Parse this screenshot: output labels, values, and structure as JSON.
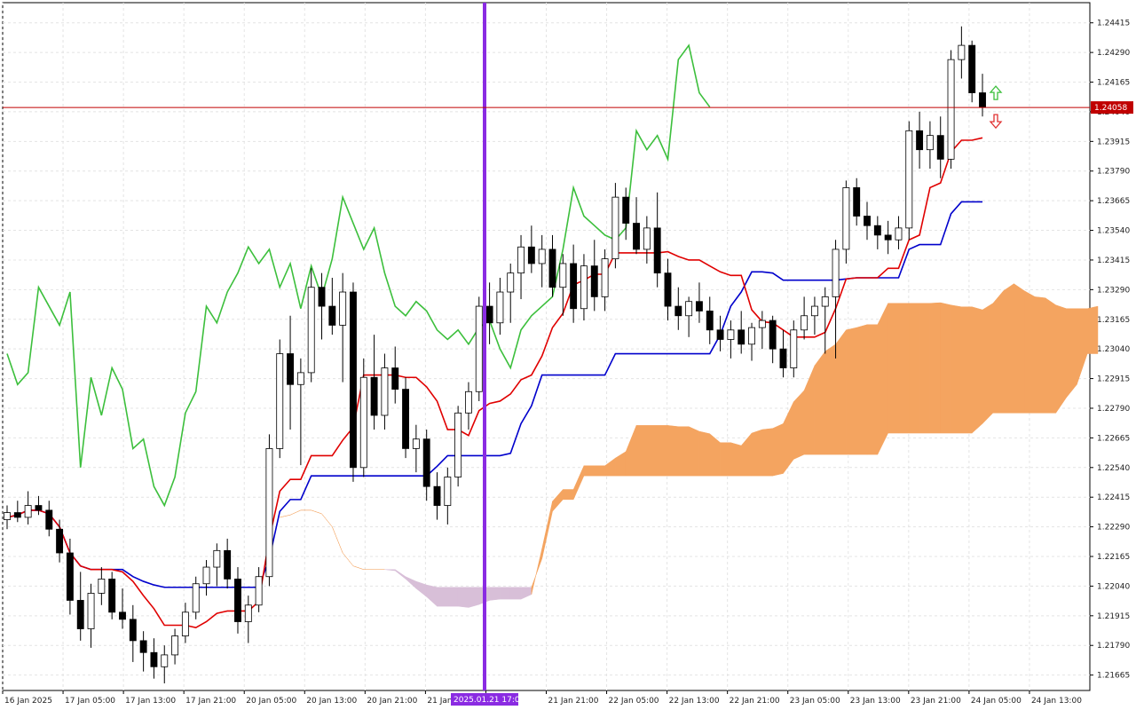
{
  "chart_data": {
    "type": "candlestick",
    "indicator": "Ichimoku Kinko Hyo",
    "price_axis": {
      "ticks": [
        "1.24415",
        "1.24290",
        "1.24165",
        "1.24040",
        "1.23915",
        "1.23790",
        "1.23665",
        "1.23540",
        "1.23415",
        "1.23290",
        "1.23165",
        "1.23040",
        "1.22915",
        "1.22790",
        "1.22665",
        "1.22540",
        "1.22415",
        "1.22290",
        "1.22165",
        "1.22040",
        "1.21915",
        "1.21790",
        "1.21665"
      ],
      "range": [
        1.216,
        1.245
      ]
    },
    "time_axis": {
      "ticks": [
        "16 Jan 2025",
        "17 Jan 05:00",
        "17 Jan 13:00",
        "17 Jan 21:00",
        "20 Jan 05:00",
        "20 Jan 13:00",
        "20 Jan 21:00",
        "21 Jan 05:00",
        "2025.01.21 17:00",
        "21 Jan 21:00",
        "22 Jan 05:00",
        "22 Jan 13:00",
        "22 Jan 21:00",
        "23 Jan 05:00",
        "23 Jan 13:00",
        "23 Jan 21:00",
        "24 Jan 05:00",
        "24 Jan 13:00"
      ]
    },
    "current_price": "1.24058",
    "crosshair_label": "2025.01.21 17:00",
    "colors": {
      "bull_body": "#ffffff",
      "bear_body": "#000000",
      "wick": "#000000",
      "tenkan": "#e00000",
      "kijun": "#0000cc",
      "chikou": "#3cbf3c",
      "bull_cloud": "#f4a460",
      "bear_cloud": "#d8bfd8",
      "crosshair": "#8a2be2",
      "price_line": "#c00000",
      "arrow_up": "#3cbf3c",
      "arrow_down": "#e03030"
    },
    "candles": [
      {
        "o": 1.2232,
        "h": 1.2238,
        "l": 1.2228,
        "c": 1.2235
      },
      {
        "o": 1.2235,
        "h": 1.224,
        "l": 1.2231,
        "c": 1.2233
      },
      {
        "o": 1.2233,
        "h": 1.2244,
        "l": 1.223,
        "c": 1.2238
      },
      {
        "o": 1.2238,
        "h": 1.2242,
        "l": 1.2234,
        "c": 1.2236
      },
      {
        "o": 1.2236,
        "h": 1.224,
        "l": 1.2225,
        "c": 1.2228
      },
      {
        "o": 1.2228,
        "h": 1.2232,
        "l": 1.2214,
        "c": 1.2218
      },
      {
        "o": 1.2218,
        "h": 1.2224,
        "l": 1.2192,
        "c": 1.2198
      },
      {
        "o": 1.2198,
        "h": 1.221,
        "l": 1.2181,
        "c": 1.2186
      },
      {
        "o": 1.2186,
        "h": 1.2205,
        "l": 1.2178,
        "c": 1.2201
      },
      {
        "o": 1.2201,
        "h": 1.2212,
        "l": 1.2196,
        "c": 1.2207
      },
      {
        "o": 1.2207,
        "h": 1.221,
        "l": 1.219,
        "c": 1.2193
      },
      {
        "o": 1.2193,
        "h": 1.2203,
        "l": 1.2186,
        "c": 1.219
      },
      {
        "o": 1.219,
        "h": 1.2196,
        "l": 1.2172,
        "c": 1.2181
      },
      {
        "o": 1.2181,
        "h": 1.2185,
        "l": 1.2168,
        "c": 1.2176
      },
      {
        "o": 1.2176,
        "h": 1.2182,
        "l": 1.2165,
        "c": 1.217
      },
      {
        "o": 1.217,
        "h": 1.2179,
        "l": 1.2163,
        "c": 1.2175
      },
      {
        "o": 1.2175,
        "h": 1.2186,
        "l": 1.2171,
        "c": 1.2183
      },
      {
        "o": 1.2183,
        "h": 1.2197,
        "l": 1.218,
        "c": 1.2193
      },
      {
        "o": 1.2193,
        "h": 1.2208,
        "l": 1.219,
        "c": 1.2205
      },
      {
        "o": 1.2205,
        "h": 1.2215,
        "l": 1.22,
        "c": 1.2212
      },
      {
        "o": 1.2212,
        "h": 1.2222,
        "l": 1.2204,
        "c": 1.2219
      },
      {
        "o": 1.2219,
        "h": 1.2224,
        "l": 1.2203,
        "c": 1.2207
      },
      {
        "o": 1.2207,
        "h": 1.2212,
        "l": 1.2184,
        "c": 1.2189
      },
      {
        "o": 1.2189,
        "h": 1.22,
        "l": 1.218,
        "c": 1.2196
      },
      {
        "o": 1.2196,
        "h": 1.2212,
        "l": 1.2193,
        "c": 1.2208
      },
      {
        "o": 1.2208,
        "h": 1.2268,
        "l": 1.2204,
        "c": 1.2262
      },
      {
        "o": 1.2262,
        "h": 1.2308,
        "l": 1.2258,
        "c": 1.2302
      },
      {
        "o": 1.2302,
        "h": 1.2318,
        "l": 1.227,
        "c": 1.2289
      },
      {
        "o": 1.2289,
        "h": 1.23,
        "l": 1.2255,
        "c": 1.2294
      },
      {
        "o": 1.2294,
        "h": 1.2338,
        "l": 1.229,
        "c": 1.233
      },
      {
        "o": 1.233,
        "h": 1.2336,
        "l": 1.2308,
        "c": 1.2322
      },
      {
        "o": 1.2322,
        "h": 1.2334,
        "l": 1.231,
        "c": 1.2314
      },
      {
        "o": 1.2314,
        "h": 1.2336,
        "l": 1.229,
        "c": 1.2328
      },
      {
        "o": 1.2328,
        "h": 1.2332,
        "l": 1.2248,
        "c": 1.2254
      },
      {
        "o": 1.2254,
        "h": 1.23,
        "l": 1.225,
        "c": 1.2292
      },
      {
        "o": 1.2292,
        "h": 1.231,
        "l": 1.227,
        "c": 1.2276
      },
      {
        "o": 1.2276,
        "h": 1.2302,
        "l": 1.227,
        "c": 1.2296
      },
      {
        "o": 1.2296,
        "h": 1.2305,
        "l": 1.2281,
        "c": 1.2287
      },
      {
        "o": 1.2287,
        "h": 1.2292,
        "l": 1.2258,
        "c": 1.2262
      },
      {
        "o": 1.2262,
        "h": 1.2272,
        "l": 1.2252,
        "c": 1.2266
      },
      {
        "o": 1.2266,
        "h": 1.227,
        "l": 1.224,
        "c": 1.2246
      },
      {
        "o": 1.2246,
        "h": 1.2252,
        "l": 1.2232,
        "c": 1.2238
      },
      {
        "o": 1.2238,
        "h": 1.2254,
        "l": 1.223,
        "c": 1.225
      },
      {
        "o": 1.225,
        "h": 1.228,
        "l": 1.2246,
        "c": 1.2277
      },
      {
        "o": 1.2277,
        "h": 1.229,
        "l": 1.227,
        "c": 1.2286
      },
      {
        "o": 1.2286,
        "h": 1.2326,
        "l": 1.2282,
        "c": 1.2322
      },
      {
        "o": 1.2322,
        "h": 1.2332,
        "l": 1.2306,
        "c": 1.2315
      },
      {
        "o": 1.2315,
        "h": 1.2334,
        "l": 1.231,
        "c": 1.2328
      },
      {
        "o": 1.2328,
        "h": 1.234,
        "l": 1.2315,
        "c": 1.2336
      },
      {
        "o": 1.2336,
        "h": 1.2352,
        "l": 1.2325,
        "c": 1.2347
      },
      {
        "o": 1.2347,
        "h": 1.2356,
        "l": 1.2336,
        "c": 1.234
      },
      {
        "o": 1.234,
        "h": 1.2352,
        "l": 1.233,
        "c": 1.2346
      },
      {
        "o": 1.2346,
        "h": 1.2352,
        "l": 1.2326,
        "c": 1.233
      },
      {
        "o": 1.233,
        "h": 1.2344,
        "l": 1.2318,
        "c": 1.234
      },
      {
        "o": 1.234,
        "h": 1.2348,
        "l": 1.2315,
        "c": 1.2321
      },
      {
        "o": 1.2321,
        "h": 1.2344,
        "l": 1.2316,
        "c": 1.2339
      },
      {
        "o": 1.2339,
        "h": 1.235,
        "l": 1.232,
        "c": 1.2326
      },
      {
        "o": 1.2326,
        "h": 1.2346,
        "l": 1.232,
        "c": 1.2342
      },
      {
        "o": 1.2342,
        "h": 1.2374,
        "l": 1.2338,
        "c": 1.2368
      },
      {
        "o": 1.2368,
        "h": 1.2372,
        "l": 1.235,
        "c": 1.2357
      },
      {
        "o": 1.2357,
        "h": 1.2368,
        "l": 1.2344,
        "c": 1.2346
      },
      {
        "o": 1.2346,
        "h": 1.236,
        "l": 1.234,
        "c": 1.2355
      },
      {
        "o": 1.2355,
        "h": 1.237,
        "l": 1.233,
        "c": 1.2336
      },
      {
        "o": 1.2336,
        "h": 1.2342,
        "l": 1.2316,
        "c": 1.2322
      },
      {
        "o": 1.2322,
        "h": 1.233,
        "l": 1.2312,
        "c": 1.2318
      },
      {
        "o": 1.2318,
        "h": 1.2326,
        "l": 1.2309,
        "c": 1.2324
      },
      {
        "o": 1.2324,
        "h": 1.2332,
        "l": 1.2315,
        "c": 1.232
      },
      {
        "o": 1.232,
        "h": 1.2326,
        "l": 1.2306,
        "c": 1.2312
      },
      {
        "o": 1.2312,
        "h": 1.2318,
        "l": 1.2303,
        "c": 1.2308
      },
      {
        "o": 1.2308,
        "h": 1.2316,
        "l": 1.23,
        "c": 1.2312
      },
      {
        "o": 1.2312,
        "h": 1.232,
        "l": 1.2302,
        "c": 1.2306
      },
      {
        "o": 1.2306,
        "h": 1.2315,
        "l": 1.2299,
        "c": 1.2313
      },
      {
        "o": 1.2313,
        "h": 1.232,
        "l": 1.2304,
        "c": 1.2316
      },
      {
        "o": 1.2316,
        "h": 1.2318,
        "l": 1.2298,
        "c": 1.2304
      },
      {
        "o": 1.2304,
        "h": 1.2312,
        "l": 1.2292,
        "c": 1.2296
      },
      {
        "o": 1.2296,
        "h": 1.2316,
        "l": 1.2292,
        "c": 1.2312
      },
      {
        "o": 1.2312,
        "h": 1.2326,
        "l": 1.2308,
        "c": 1.2318
      },
      {
        "o": 1.2318,
        "h": 1.2326,
        "l": 1.231,
        "c": 1.2322
      },
      {
        "o": 1.2322,
        "h": 1.233,
        "l": 1.2302,
        "c": 1.2326
      },
      {
        "o": 1.2326,
        "h": 1.235,
        "l": 1.23,
        "c": 1.2346
      },
      {
        "o": 1.2346,
        "h": 1.2375,
        "l": 1.234,
        "c": 1.2372
      },
      {
        "o": 1.2372,
        "h": 1.2376,
        "l": 1.2356,
        "c": 1.236
      },
      {
        "o": 1.236,
        "h": 1.2366,
        "l": 1.235,
        "c": 1.2356
      },
      {
        "o": 1.2356,
        "h": 1.236,
        "l": 1.2346,
        "c": 1.2352
      },
      {
        "o": 1.2352,
        "h": 1.2358,
        "l": 1.2344,
        "c": 1.235
      },
      {
        "o": 1.235,
        "h": 1.236,
        "l": 1.2346,
        "c": 1.2355
      },
      {
        "o": 1.2355,
        "h": 1.24,
        "l": 1.235,
        "c": 1.2396
      },
      {
        "o": 1.2396,
        "h": 1.2404,
        "l": 1.238,
        "c": 1.2388
      },
      {
        "o": 1.2388,
        "h": 1.24,
        "l": 1.238,
        "c": 1.2394
      },
      {
        "o": 1.2394,
        "h": 1.2402,
        "l": 1.2376,
        "c": 1.2384
      },
      {
        "o": 1.2384,
        "h": 1.243,
        "l": 1.238,
        "c": 1.2426
      },
      {
        "o": 1.2426,
        "h": 1.244,
        "l": 1.2418,
        "c": 1.2432
      },
      {
        "o": 1.2432,
        "h": 1.2434,
        "l": 1.2408,
        "c": 1.2412
      },
      {
        "o": 1.2412,
        "h": 1.242,
        "l": 1.2402,
        "c": 1.2406
      }
    ]
  }
}
